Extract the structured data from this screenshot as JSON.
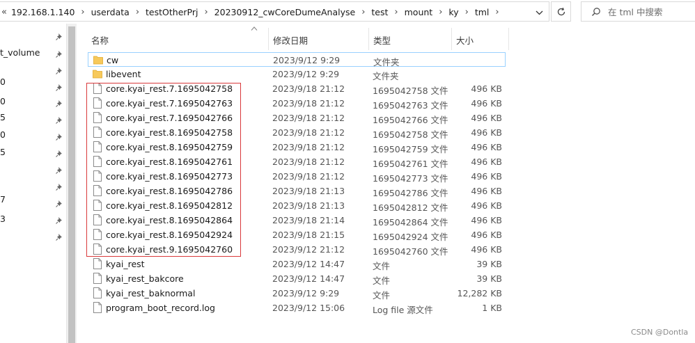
{
  "address": {
    "lead": "«",
    "crumbs": [
      "192.168.1.140",
      "userdata",
      "testOtherPrj",
      "20230912_cwCoreDumeAnalyse",
      "test",
      "mount",
      "ky",
      "tml"
    ],
    "dropdown_icon": "chevron-down-icon",
    "refresh_icon": "refresh-icon"
  },
  "search": {
    "placeholder": "在 tml 中搜索",
    "icon": "search-icon"
  },
  "nav": {
    "items": [
      {
        "label": "t_volume"
      },
      {
        "label": "0"
      },
      {
        "label": "0"
      },
      {
        "label": "5"
      },
      {
        "label": "0"
      },
      {
        "label": "5"
      },
      {
        "label": "7"
      },
      {
        "label": "3"
      }
    ]
  },
  "columns": {
    "name": "名称",
    "date": "修改日期",
    "type": "类型",
    "size": "大小"
  },
  "files": [
    {
      "name": "cw",
      "date": "2023/9/12 9:29",
      "type": "文件夹",
      "size": "",
      "kind": "folder"
    },
    {
      "name": "libevent",
      "date": "2023/9/12 9:29",
      "type": "文件夹",
      "size": "",
      "kind": "folder"
    },
    {
      "name": "core.kyai_rest.7.1695042758",
      "date": "2023/9/18 21:12",
      "type": "1695042758 文件",
      "size": "496 KB",
      "kind": "file"
    },
    {
      "name": "core.kyai_rest.7.1695042763",
      "date": "2023/9/18 21:12",
      "type": "1695042763 文件",
      "size": "496 KB",
      "kind": "file"
    },
    {
      "name": "core.kyai_rest.7.1695042766",
      "date": "2023/9/18 21:12",
      "type": "1695042766 文件",
      "size": "496 KB",
      "kind": "file"
    },
    {
      "name": "core.kyai_rest.8.1695042758",
      "date": "2023/9/18 21:12",
      "type": "1695042758 文件",
      "size": "496 KB",
      "kind": "file"
    },
    {
      "name": "core.kyai_rest.8.1695042759",
      "date": "2023/9/18 21:12",
      "type": "1695042759 文件",
      "size": "496 KB",
      "kind": "file"
    },
    {
      "name": "core.kyai_rest.8.1695042761",
      "date": "2023/9/18 21:12",
      "type": "1695042761 文件",
      "size": "496 KB",
      "kind": "file"
    },
    {
      "name": "core.kyai_rest.8.1695042773",
      "date": "2023/9/18 21:12",
      "type": "1695042773 文件",
      "size": "496 KB",
      "kind": "file"
    },
    {
      "name": "core.kyai_rest.8.1695042786",
      "date": "2023/9/18 21:13",
      "type": "1695042786 文件",
      "size": "496 KB",
      "kind": "file"
    },
    {
      "name": "core.kyai_rest.8.1695042812",
      "date": "2023/9/18 21:13",
      "type": "1695042812 文件",
      "size": "496 KB",
      "kind": "file"
    },
    {
      "name": "core.kyai_rest.8.1695042864",
      "date": "2023/9/18 21:14",
      "type": "1695042864 文件",
      "size": "496 KB",
      "kind": "file"
    },
    {
      "name": "core.kyai_rest.8.1695042924",
      "date": "2023/9/18 21:15",
      "type": "1695042924 文件",
      "size": "496 KB",
      "kind": "file"
    },
    {
      "name": "core.kyai_rest.9.1695042760",
      "date": "2023/9/12 21:12",
      "type": "1695042760 文件",
      "size": "496 KB",
      "kind": "file"
    },
    {
      "name": "kyai_rest",
      "date": "2023/9/12 14:47",
      "type": "文件",
      "size": "39 KB",
      "kind": "file"
    },
    {
      "name": "kyai_rest_bakcore",
      "date": "2023/9/12 14:47",
      "type": "文件",
      "size": "39 KB",
      "kind": "file"
    },
    {
      "name": "kyai_rest_baknormal",
      "date": "2023/9/12 9:29",
      "type": "文件",
      "size": "12,282 KB",
      "kind": "file"
    },
    {
      "name": "program_boot_record.log",
      "date": "2023/9/12 15:06",
      "type": "Log file 源文件",
      "size": "1 KB",
      "kind": "file"
    }
  ],
  "watermark": "CSDN @Dontla",
  "colors": {
    "selection_border": "#99d1ff",
    "highlight_box": "#d9383a",
    "folder": "#f7c95b"
  }
}
